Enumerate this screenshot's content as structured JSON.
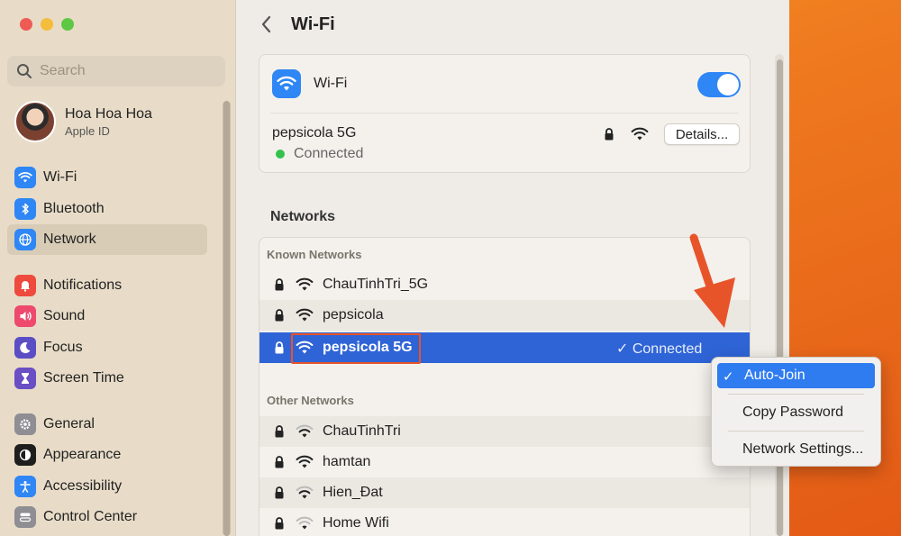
{
  "sidebar": {
    "search_placeholder": "Search",
    "profile": {
      "name": "Hoa Hoa Hoa",
      "subtitle": "Apple ID"
    },
    "items": [
      {
        "label": "Wi-Fi",
        "icon": "wifi-icon",
        "color": "#2f86f5"
      },
      {
        "label": "Bluetooth",
        "icon": "bluetooth-icon",
        "color": "#2f86f5"
      },
      {
        "label": "Network",
        "icon": "globe-icon",
        "color": "#2f86f5"
      },
      {
        "label": "Notifications",
        "icon": "bell-icon",
        "color": "#ee4a3e"
      },
      {
        "label": "Sound",
        "icon": "speaker-icon",
        "color": "#ee4a6e"
      },
      {
        "label": "Focus",
        "icon": "moon-icon",
        "color": "#5b4ec4"
      },
      {
        "label": "Screen Time",
        "icon": "hourglass-icon",
        "color": "#6a4ec4"
      },
      {
        "label": "General",
        "icon": "gear-icon",
        "color": "#8e8e93"
      },
      {
        "label": "Appearance",
        "icon": "appearance-icon",
        "color": "#1e1e1e"
      },
      {
        "label": "Accessibility",
        "icon": "accessibility-icon",
        "color": "#2f86f5"
      },
      {
        "label": "Control Center",
        "icon": "control-center-icon",
        "color": "#8e8e93"
      }
    ],
    "active_item": "Network"
  },
  "main": {
    "title": "Wi-Fi",
    "wifi_label": "Wi-Fi",
    "wifi_enabled": true,
    "current_network": {
      "name": "pepsicola 5G",
      "status": "Connected",
      "details_label": "Details..."
    },
    "section_title": "Networks",
    "known_header": "Known Networks",
    "known_networks": [
      {
        "name": "ChauTinhTri_5G"
      },
      {
        "name": "pepsicola"
      },
      {
        "name": "pepsicola 5G",
        "status": "✓ Connected"
      }
    ],
    "other_header": "Other Networks",
    "other_networks": [
      {
        "name": "ChauTinhTri"
      },
      {
        "name": "hamtan"
      },
      {
        "name": "Hien_Đat"
      },
      {
        "name": "Home Wifi"
      }
    ]
  },
  "context_menu": {
    "items": [
      {
        "label": "Auto-Join",
        "checked": true
      },
      {
        "label": "Copy Password"
      },
      {
        "label": "Network Settings..."
      }
    ]
  },
  "colors": {
    "accent": "#2f86f5",
    "selection": "#2f64d6",
    "highlight": "#e8542a",
    "connected": "#33c24d"
  }
}
